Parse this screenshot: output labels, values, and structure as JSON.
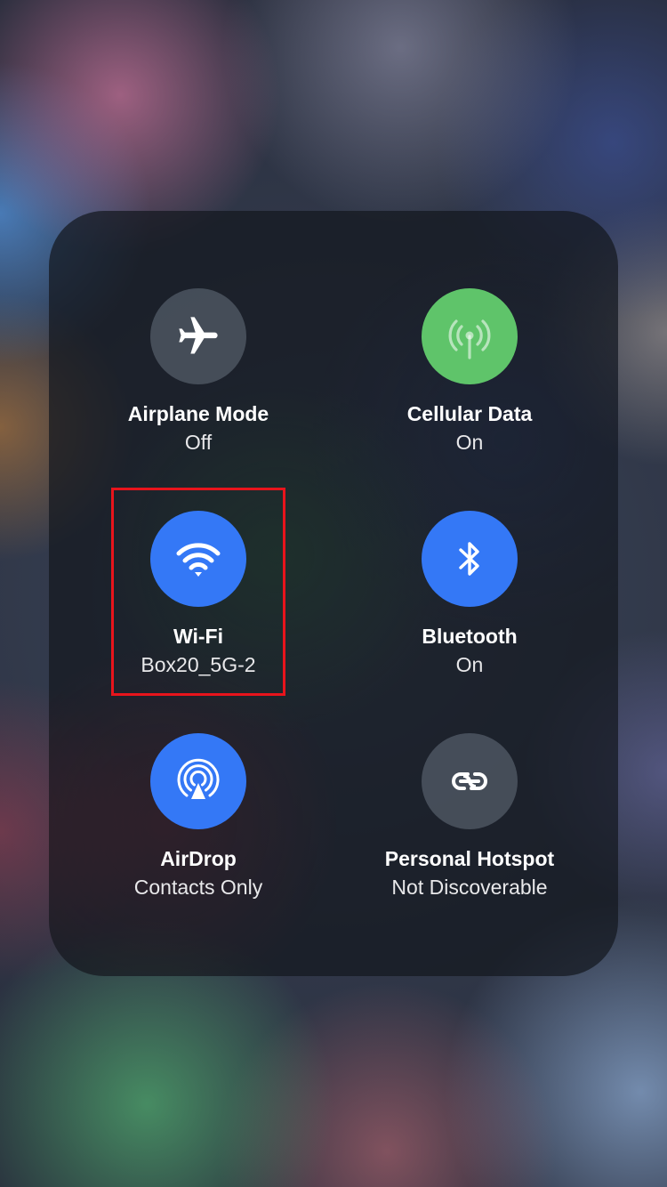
{
  "colors": {
    "active_blue": "#3478f6",
    "active_green": "#5fc46a",
    "inactive": "rgba(120,130,145,0.45)",
    "highlight_red": "#e8141c"
  },
  "tiles": [
    {
      "label": "Airplane Mode",
      "status": "Off",
      "icon": "airplane-icon",
      "state": "inactive"
    },
    {
      "label": "Cellular Data",
      "status": "On",
      "icon": "antenna-icon",
      "state": "active_green"
    },
    {
      "label": "Wi-Fi",
      "status": "Box20_5G-2",
      "icon": "wifi-icon",
      "state": "active_blue"
    },
    {
      "label": "Bluetooth",
      "status": "On",
      "icon": "bluetooth-icon",
      "state": "active_blue"
    },
    {
      "label": "AirDrop",
      "status": "Contacts Only",
      "icon": "airdrop-icon",
      "state": "active_blue"
    },
    {
      "label": "Personal Hotspot",
      "status": "Not Discoverable",
      "icon": "hotspot-link-icon",
      "state": "inactive"
    }
  ]
}
